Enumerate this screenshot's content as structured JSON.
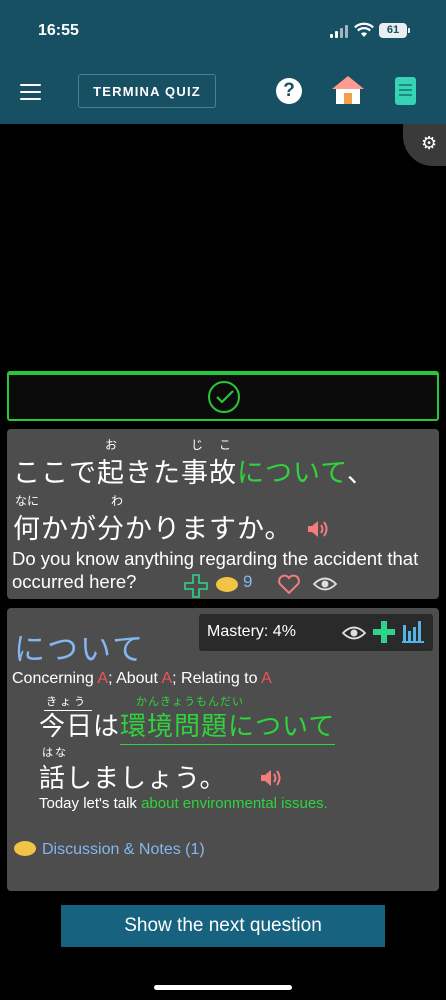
{
  "status_bar": {
    "time": "16:55",
    "battery": "61"
  },
  "header": {
    "title_button": "TERMINA QUIZ",
    "help_icon": "?",
    "icons": [
      "menu-icon",
      "help-icon",
      "home-icon",
      "book-icon"
    ],
    "accent": "#174f63"
  },
  "settings": {
    "gear_icon": "⚙"
  },
  "result": {
    "state": "correct",
    "color": "#29c73a"
  },
  "question": {
    "line1": [
      "ここで",
      "起",
      "きた",
      "事故",
      "について",
      "、"
    ],
    "line1_ruby": {
      "起": "お",
      "事": "じ",
      "故": "こ"
    },
    "line2": [
      "何",
      "かが",
      "分",
      "かりますか。"
    ],
    "line2_ruby": {
      "何": "なに",
      "分": "わ"
    },
    "translation": "Do you know anything regarding the accident that occurred here?",
    "comment_count": "9",
    "icons": [
      "speaker-icon",
      "add-icon",
      "comment-icon",
      "heart-icon",
      "eye-icon"
    ]
  },
  "grammar": {
    "title": "について",
    "mastery_label": "Mastery: 4%",
    "meaning": [
      {
        "text": "Concerning ",
        "a": "A"
      },
      {
        "text": "; About ",
        "a": "A"
      },
      {
        "text": "; Relating to ",
        "a": "A"
      }
    ],
    "example_line1": [
      "今日",
      "は",
      "環境問題について"
    ],
    "example_line1_ruby": {
      "今日": "きょう",
      "環境問題": "かんきょうもんだい"
    },
    "example_line2": [
      "話",
      "しましょう。"
    ],
    "example_line2_ruby": {
      "話": "はな"
    },
    "example_en_plain": "Today let's talk ",
    "example_en_green": "about environmental issues.",
    "discussion_label": "Discussion & Notes (1)"
  },
  "next_button": "Show the next question"
}
